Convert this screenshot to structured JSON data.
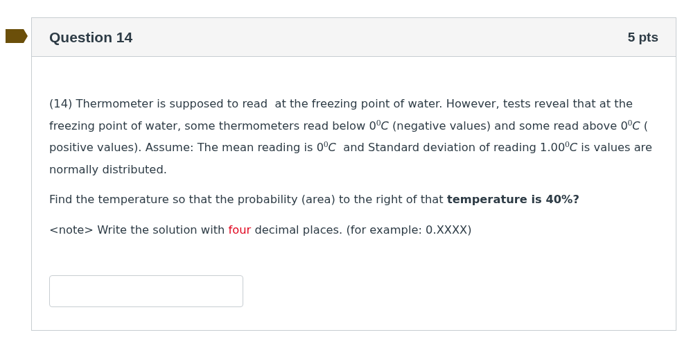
{
  "question": {
    "title": "Question 14",
    "points": "5 pts",
    "flagged": true,
    "paragraphs": [
      {
        "segments": [
          {
            "kind": "rich",
            "text": "(14) Thermometer is supposed to read  at the freezing point of water. However, tests reveal that at the freezing point of water, some thermometers read below 0$^{0}$*C* (negative values) and some read above 0$^{0}$*C* ( positive values). Assume: The mean reading is 0$^{0}$*C*  and Standard deviation of reading 1.00$^{0}$*C* is values are normally distributed."
          }
        ]
      },
      {
        "segments": [
          {
            "kind": "rich",
            "text": "Find the temperature so that the probability (area) to the right of that **temperature is 40%?**"
          }
        ]
      },
      {
        "segments": [
          {
            "kind": "rich",
            "text": "<note> Write the solution with "
          },
          {
            "kind": "highlight",
            "text": "four"
          },
          {
            "kind": "rich",
            "text": " decimal places. (for example: 0.XXXX)"
          }
        ]
      }
    ],
    "answer": {
      "kind": "text"
    }
  }
}
